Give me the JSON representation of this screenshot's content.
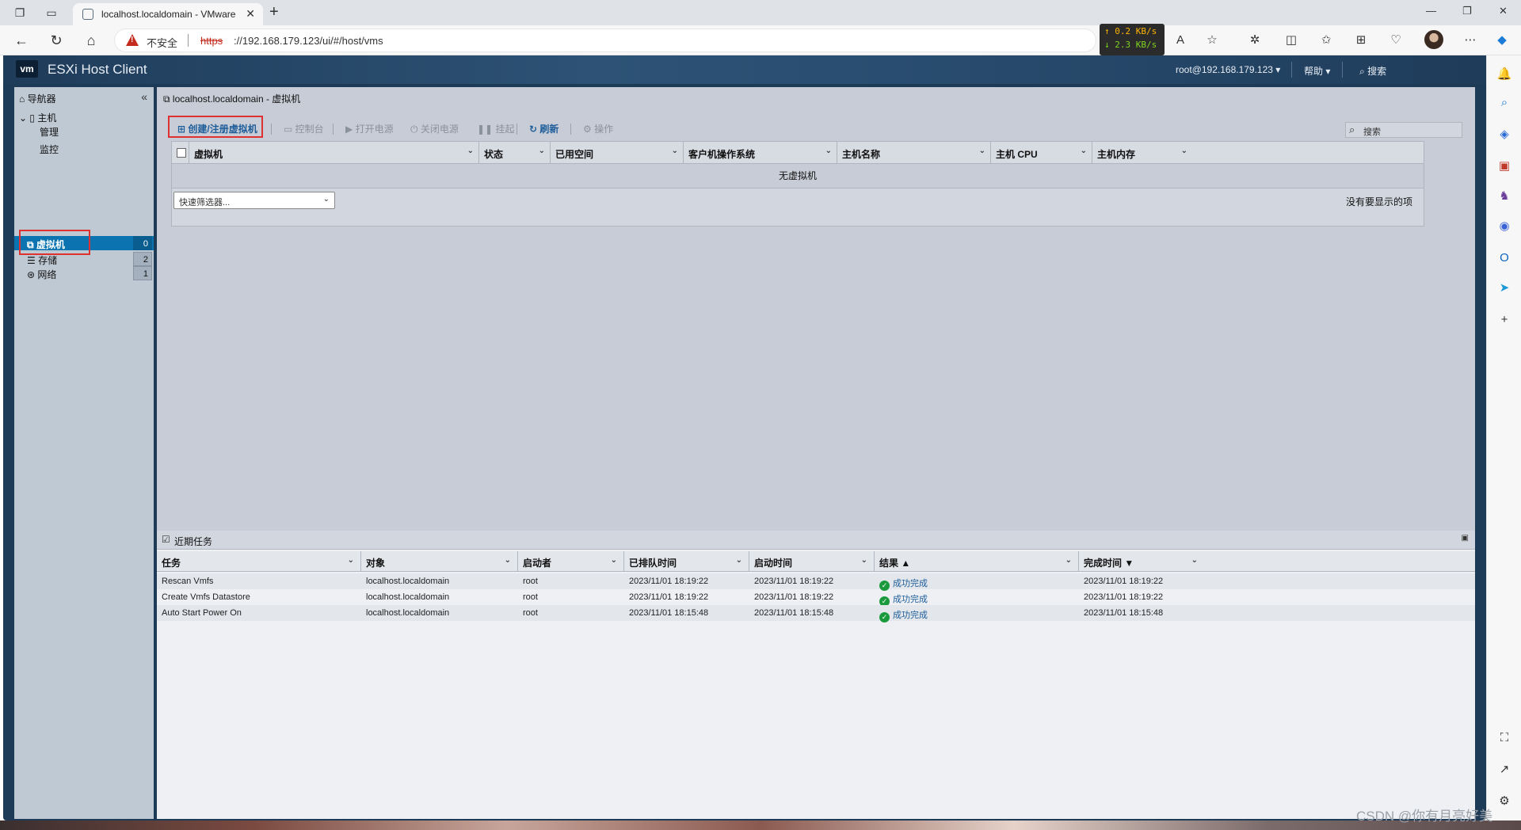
{
  "browser": {
    "tab_title": "localhost.localdomain - VMware",
    "insecure_label": "不安全",
    "url_scheme": "https",
    "url_rest": "://192.168.179.123/ui/#/host/vms",
    "net_up": "↑ 0.2 KB/s",
    "net_down": "↓ 2.3 KB/s"
  },
  "esxi": {
    "logo": "vm",
    "title": "ESXi Host Client",
    "user": "root@192.168.179.123 ▾",
    "help": "帮助 ▾",
    "search": "搜索"
  },
  "navigator": {
    "title": "导航器",
    "host": "主机",
    "manage": "管理",
    "monitor": "监控",
    "vms": "虚拟机",
    "vms_count": "0",
    "storage": "存储",
    "storage_count": "2",
    "network": "网络",
    "network_count": "1"
  },
  "main": {
    "breadcrumb": "localhost.localdomain - 虚拟机",
    "toolbar": {
      "create": "创建/注册虚拟机",
      "console": "控制台",
      "power_on": "打开电源",
      "power_off": "关闭电源",
      "suspend": "挂起",
      "refresh": "刷新",
      "actions": "操作",
      "search_placeholder": "搜索"
    },
    "columns": [
      "虚拟机",
      "状态",
      "已用空间",
      "客户机操作系统",
      "主机名称",
      "主机 CPU",
      "主机内存"
    ],
    "empty": "无虚拟机",
    "quick_filter": "快速筛选器...",
    "no_items": "没有要显示的项"
  },
  "tasks": {
    "title": "近期任务",
    "columns": [
      "任务",
      "对象",
      "启动者",
      "已排队时间",
      "启动时间",
      "结果 ▲",
      "完成时间 ▼"
    ],
    "rows": [
      {
        "task": "Rescan Vmfs",
        "object": "localhost.localdomain",
        "initiator": "root",
        "queued": "2023/11/01 18:19:22",
        "started": "2023/11/01 18:19:22",
        "result": "成功完成",
        "completed": "2023/11/01 18:19:22"
      },
      {
        "task": "Create Vmfs Datastore",
        "object": "localhost.localdomain",
        "initiator": "root",
        "queued": "2023/11/01 18:19:22",
        "started": "2023/11/01 18:19:22",
        "result": "成功完成",
        "completed": "2023/11/01 18:19:22"
      },
      {
        "task": "Auto Start Power On",
        "object": "localhost.localdomain",
        "initiator": "root",
        "queued": "2023/11/01 18:15:48",
        "started": "2023/11/01 18:15:48",
        "result": "成功完成",
        "completed": "2023/11/01 18:15:48"
      }
    ]
  },
  "watermark": "CSDN @你有月亮好美",
  "colors": {
    "accent": "#0a73b0",
    "highlight": "#e03131",
    "success": "#1a9a3c"
  }
}
